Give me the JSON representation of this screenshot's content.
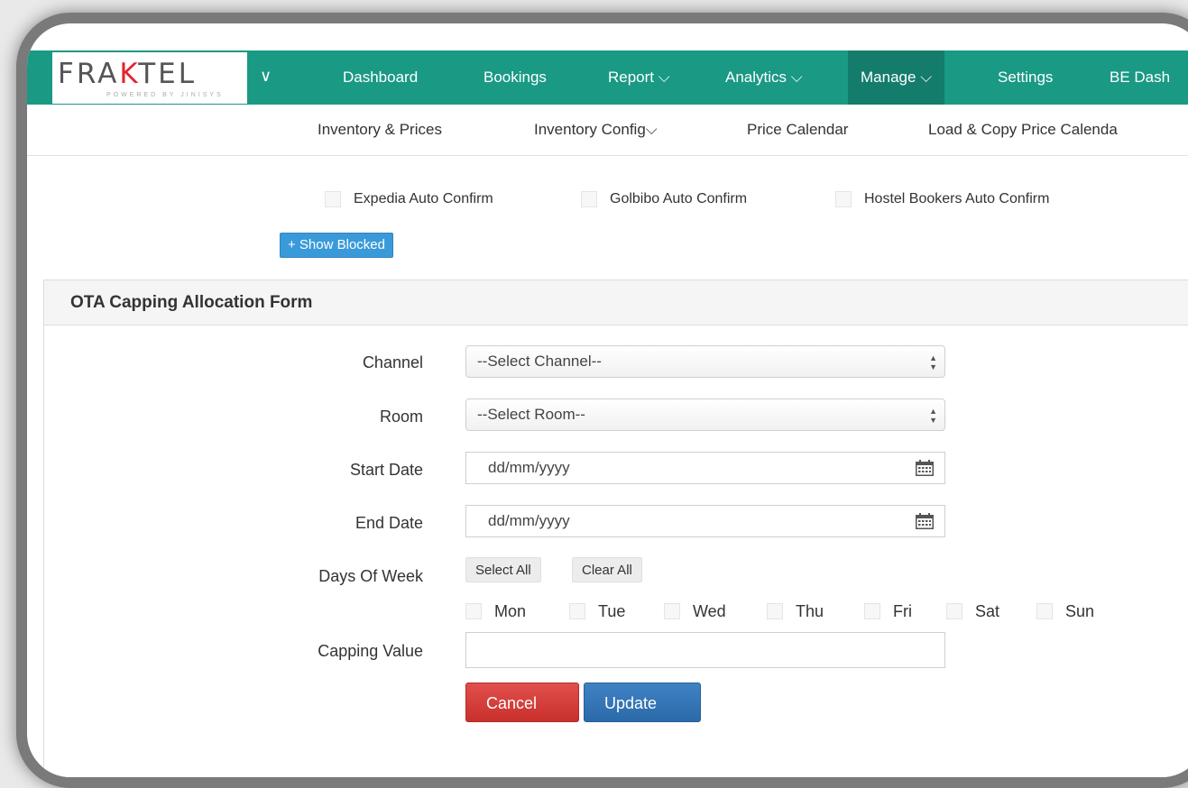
{
  "brand": {
    "logo_prefix": "FRA",
    "logo_k": "K",
    "logo_suffix": "TEL",
    "tagline": "POWERED BY JINISYS",
    "accent": "#1a9985",
    "logo_red": "#e2232c"
  },
  "topnav": {
    "items": [
      {
        "label": "Dashboard"
      },
      {
        "label": "Bookings"
      },
      {
        "label": "Report ⌵"
      },
      {
        "label": "Analytics ⌵"
      },
      {
        "label": "Manage ⌵",
        "active": true
      },
      {
        "label": "Settings"
      },
      {
        "label": "BE Dash"
      }
    ]
  },
  "subnav": {
    "items": [
      {
        "label": "Inventory & Prices"
      },
      {
        "label": "Inventory Config⌵"
      },
      {
        "label": "Price Calendar"
      },
      {
        "label": "Load & Copy Price Calenda"
      }
    ]
  },
  "auto_confirm": [
    {
      "label": "Expedia Auto Confirm",
      "checked": false
    },
    {
      "label": "Golbibo Auto Confirm",
      "checked": false
    },
    {
      "label": "Hostel Bookers Auto Confirm",
      "checked": false
    }
  ],
  "show_blocked_label": "+ Show Blocked",
  "form": {
    "title": "OTA Capping Allocation Form",
    "channel": {
      "label": "Channel",
      "value": "--Select Channel--"
    },
    "room": {
      "label": "Room",
      "value": "--Select Room--"
    },
    "start_date": {
      "label": "Start Date",
      "placeholder": "dd/mm/yyyy"
    },
    "end_date": {
      "label": "End Date",
      "placeholder": "dd/mm/yyyy"
    },
    "days_of_week": {
      "label": "Days Of Week",
      "select_all": "Select All",
      "clear_all": "Clear All",
      "days": [
        {
          "label": "Mon",
          "checked": false
        },
        {
          "label": "Tue",
          "checked": false
        },
        {
          "label": "Wed",
          "checked": false
        },
        {
          "label": "Thu",
          "checked": false
        },
        {
          "label": "Fri",
          "checked": false
        },
        {
          "label": "Sat",
          "checked": false
        },
        {
          "label": "Sun",
          "checked": false
        }
      ]
    },
    "capping_value": {
      "label": "Capping Value",
      "value": ""
    },
    "cancel_label": "Cancel",
    "update_label": "Update"
  }
}
